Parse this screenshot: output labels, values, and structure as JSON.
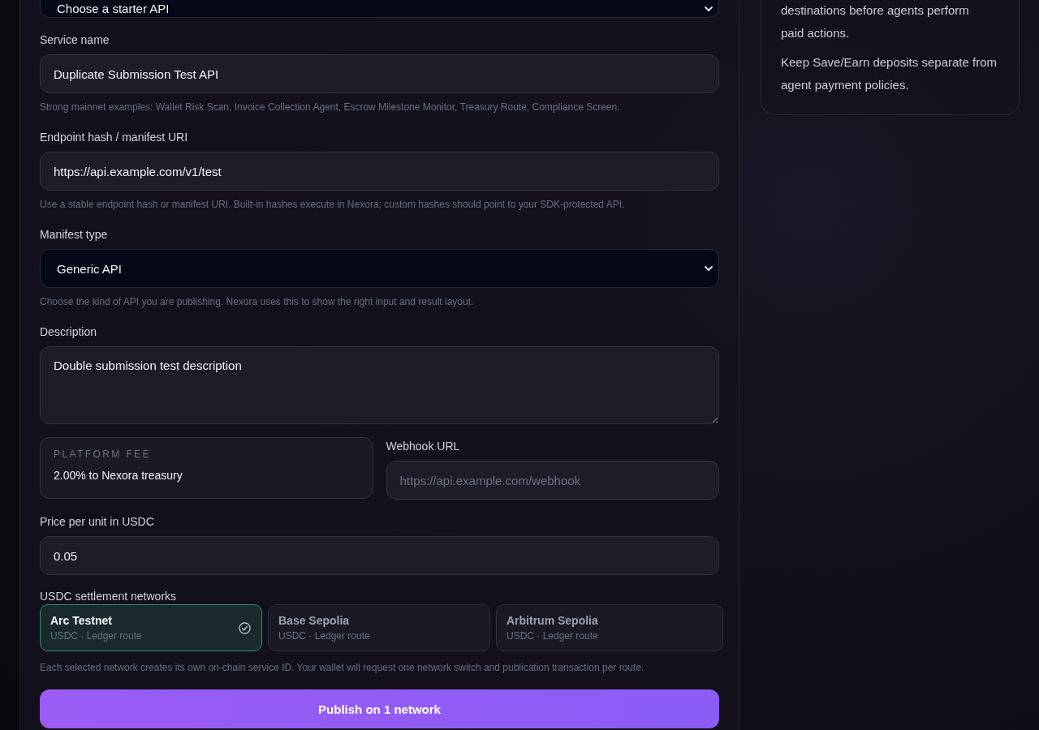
{
  "form": {
    "fields": [
      {
        "kind": "select",
        "value": "Choose a starter API"
      },
      {
        "kind": "text",
        "label": "Service name",
        "value": "Duplicate Submission Test API",
        "hint": "Strong mainnet examples: Wallet Risk Scan, Invoice Collection Agent, Escrow Milestone Monitor, Treasury Route, Compliance Screen."
      },
      {
        "kind": "text",
        "label": "Endpoint hash / manifest URI",
        "value": "https://api.example.com/v1/test",
        "hint": "Use a stable endpoint hash or manifest URI. Built-in hashes execute in Nexora; custom hashes should point to your SDK-protected API."
      },
      {
        "kind": "select",
        "label": "Manifest type",
        "value": "Generic API",
        "hint": "Choose the kind of API you are publishing. Nexora uses this to show the right input and result layout."
      },
      {
        "kind": "textarea",
        "label": "Description",
        "value": "Double submission test description"
      }
    ],
    "platform_fee": {
      "label": "PLATFORM FEE",
      "value": "2.00% to Nexora treasury"
    },
    "webhook": {
      "label": "Webhook URL",
      "placeholder": "https://api.example.com/webhook"
    },
    "price": {
      "label": "Price per unit in USDC",
      "value": "0.05"
    },
    "networks": {
      "label": "USDC settlement networks",
      "items": [
        {
          "name": "Arc Testnet",
          "detail": "USDC · Ledger route",
          "selected": true
        },
        {
          "name": "Base Sepolia",
          "detail": "USDC · Ledger route",
          "selected": false
        },
        {
          "name": "Arbitrum Sepolia",
          "detail": "USDC · Ledger route",
          "selected": false
        }
      ],
      "hint": "Each selected network creates its own on-chain service ID. Your wallet will request one network switch and publication transaction per route."
    },
    "publish_button": "Publish on 1 network"
  },
  "info_card": {
    "paragraphs": [
      "destinations before agents perform paid actions.",
      "Keep Save/Earn deposits separate from agent payment policies."
    ]
  }
}
